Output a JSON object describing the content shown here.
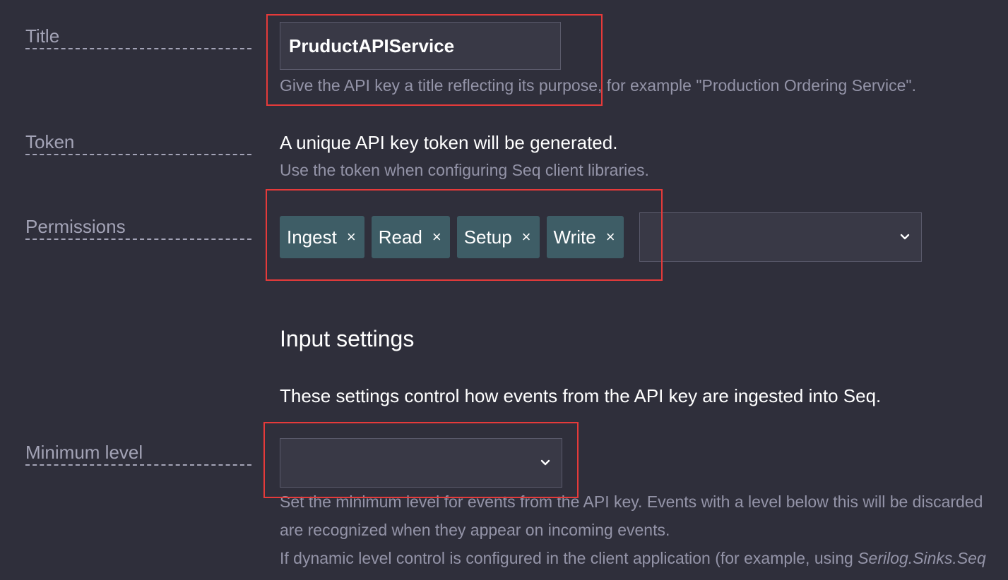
{
  "form": {
    "title_label": "Title",
    "title_value": "PruductAPIService",
    "title_help": "Give the API key a title reflecting its purpose, for example \"Production Ordering Service\".",
    "token_label": "Token",
    "token_text": "A unique API key token will be generated.",
    "token_help": "Use the token when configuring Seq client libraries.",
    "permissions_label": "Permissions",
    "permissions": [
      {
        "label": "Ingest",
        "remove": "×"
      },
      {
        "label": "Read",
        "remove": "×"
      },
      {
        "label": "Setup",
        "remove": "×"
      },
      {
        "label": "Write",
        "remove": "×"
      }
    ],
    "input_settings_heading": "Input settings",
    "input_settings_desc": "These settings control how events from the API key are ingested into Seq.",
    "min_level_label": "Minimum level",
    "min_level_help_1": "Set the minimum level for events from the API key. Events with a level below this will be discarded",
    "min_level_help_2": "are recognized when they appear on incoming events.",
    "min_level_help_3_prefix": "If dynamic level control is configured in the client application (for example, using ",
    "min_level_help_3_italic": "Serilog.Sinks.Seq"
  },
  "colors": {
    "background": "#2f2f3b",
    "chip": "#3e5d66",
    "highlight": "#e53a3a"
  }
}
